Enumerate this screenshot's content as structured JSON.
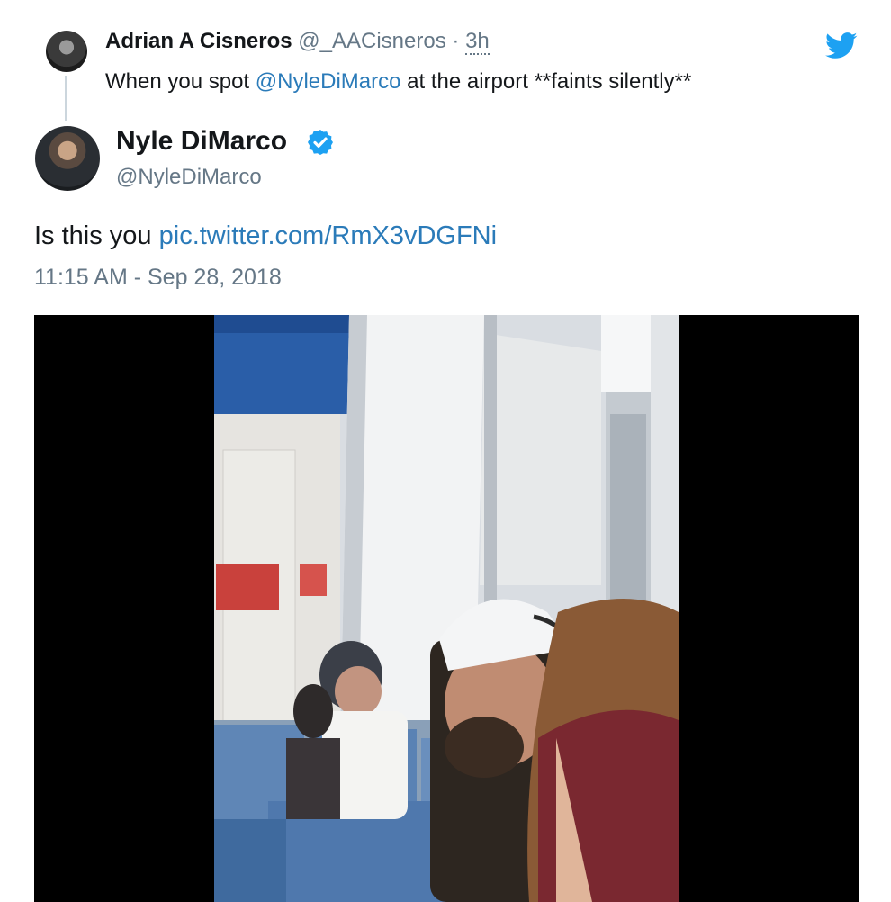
{
  "reply": {
    "author_name": "Adrian A Cisneros",
    "author_handle": "@_AACisneros",
    "separator": "·",
    "time": "3h",
    "text_before": "When you spot ",
    "mention": "@NyleDiMarco",
    "text_after": " at the airport **faints silently**"
  },
  "tweet": {
    "author_name": "Nyle DiMarco",
    "author_handle": "@NyleDiMarco",
    "verified": true,
    "text": "Is this you ",
    "link": "pic.twitter.com/RmX3vDGFNi",
    "timestamp": "11:15 AM - Sep 28, 2018"
  },
  "icons": {
    "brand": "twitter-bird-icon",
    "verified": "verified-badge-icon"
  },
  "colors": {
    "link": "#2b7bb9",
    "muted": "#657786",
    "brand": "#1da1f2"
  }
}
